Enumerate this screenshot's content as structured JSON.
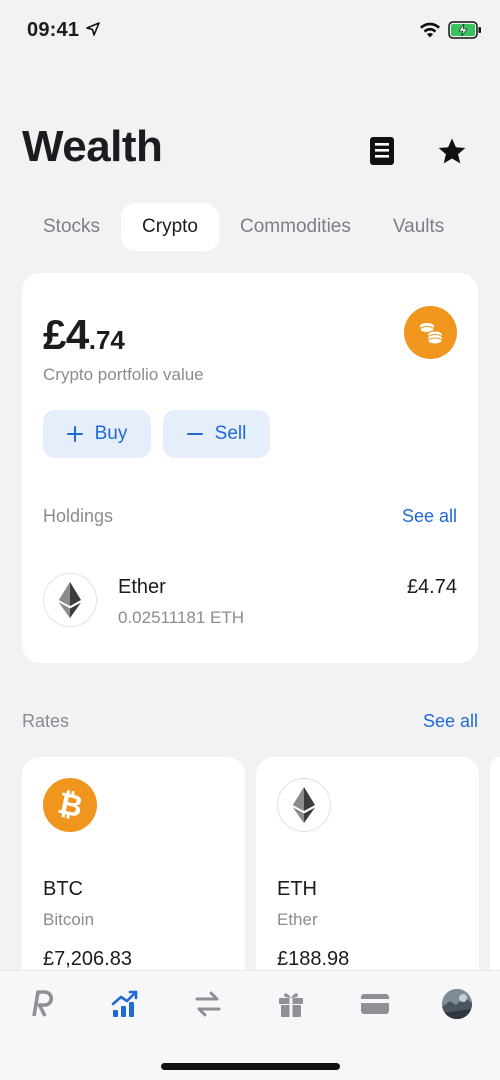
{
  "status_bar": {
    "time": "09:41",
    "icons": [
      "location-arrow-icon",
      "wifi-icon",
      "battery-charging-icon"
    ]
  },
  "header": {
    "title": "Wealth",
    "actions": [
      "news-icon",
      "star-icon"
    ]
  },
  "tabs": [
    {
      "label": "Stocks",
      "active": false
    },
    {
      "label": "Crypto",
      "active": true
    },
    {
      "label": "Commodities",
      "active": false
    },
    {
      "label": "Vaults",
      "active": false
    }
  ],
  "portfolio": {
    "value_main": "£4",
    "value_decimal": ".74",
    "label": "Crypto portfolio value",
    "badge_icon": "coins-icon",
    "buy_label": "Buy",
    "sell_label": "Sell"
  },
  "holdings": {
    "title": "Holdings",
    "see_all": "See all",
    "items": [
      {
        "name": "Ether",
        "amount": "0.02511181 ETH",
        "value": "£4.74",
        "icon": "ethereum-icon"
      }
    ]
  },
  "rates": {
    "title": "Rates",
    "see_all": "See all",
    "cards": [
      {
        "symbol": "BTC",
        "name": "Bitcoin",
        "price": "£7,206.83",
        "icon": "bitcoin-icon"
      },
      {
        "symbol": "ETH",
        "name": "Ether",
        "price": "£188.98",
        "icon": "ethereum-icon"
      }
    ]
  },
  "tab_bar": {
    "items": [
      "revolut-home-icon",
      "wealth-chart-icon",
      "transfer-icon",
      "rewards-gift-icon",
      "cards-icon",
      "profile-avatar"
    ],
    "active": "wealth-chart-icon"
  },
  "colors": {
    "accent": "#1f6ad5",
    "background": "#f2f2f4",
    "orange": "#f0961e"
  }
}
